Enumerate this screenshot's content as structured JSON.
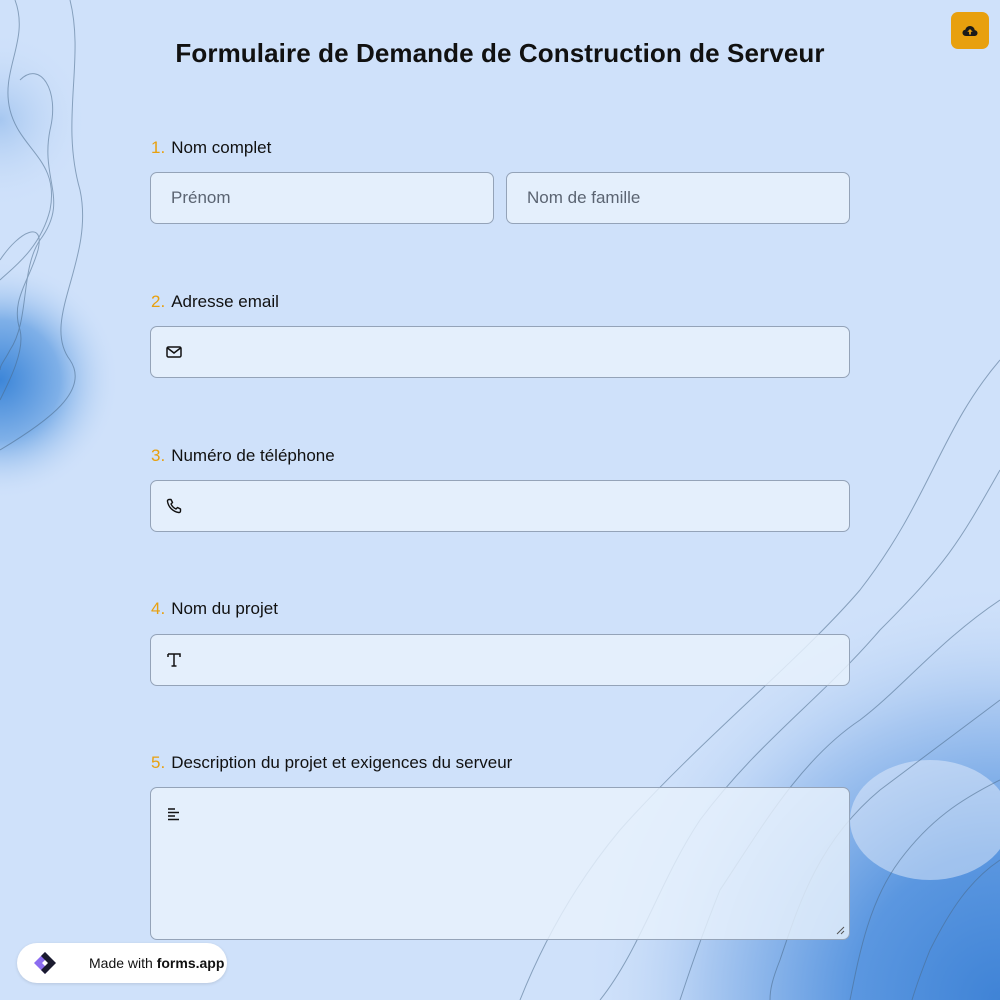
{
  "form": {
    "title": "Formulaire de Demande de Construction de Serveur"
  },
  "toolbar": {
    "upload_icon": "cloud-upload-icon",
    "accent_color": "#e8a00e"
  },
  "questions": [
    {
      "number": "1.",
      "label": "Nom complet",
      "fields": [
        {
          "placeholder": "Prénom",
          "value": ""
        },
        {
          "placeholder": "Nom de famille",
          "value": ""
        }
      ]
    },
    {
      "number": "2.",
      "label": "Adresse email",
      "icon": "mail-icon",
      "value": ""
    },
    {
      "number": "3.",
      "label": "Numéro de téléphone",
      "icon": "phone-icon",
      "value": ""
    },
    {
      "number": "4.",
      "label": "Nom du projet",
      "icon": "text-icon",
      "value": ""
    },
    {
      "number": "5.",
      "label": "Description du projet et exigences du serveur",
      "icon": "paragraph-icon",
      "value": ""
    }
  ],
  "branding": {
    "made_with": "Made with",
    "brand": "forms.app",
    "logo_icon": "forms-app-logo"
  }
}
